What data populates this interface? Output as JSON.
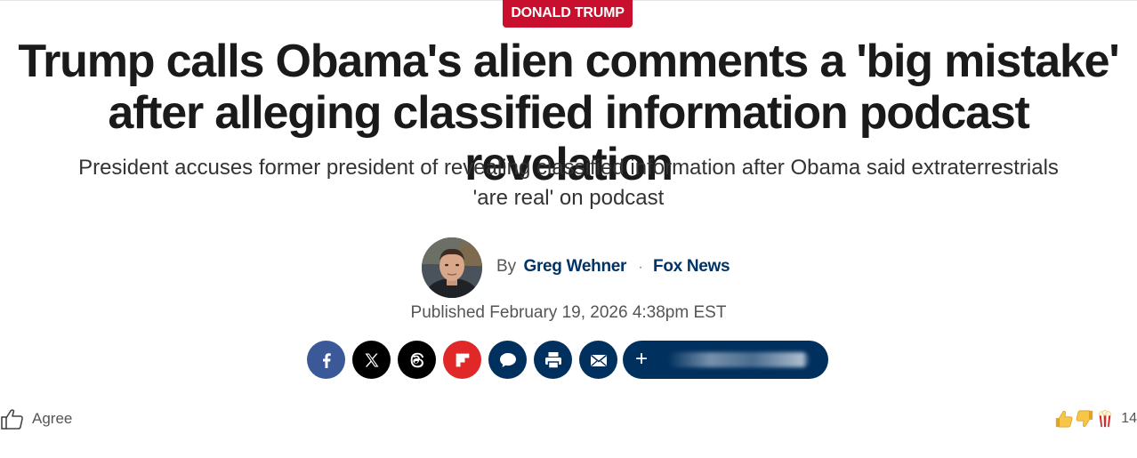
{
  "article": {
    "category": "DONALD TRUMP",
    "headline_line1": "Trump calls Obama's alien comments a 'big mistake'",
    "headline_line2": "after alleging classified information podcast revelation",
    "subhead_line1": "President accuses former president of revealing classified information after Obama said extraterrestrials",
    "subhead_line2": "'are real' on podcast",
    "byline_prefix": "By",
    "author": "Greg Wehner",
    "separator": "·",
    "outlet": "Fox News",
    "published": "Published February 19, 2026 4:38pm EST"
  },
  "share": {
    "buttons": [
      {
        "name": "facebook",
        "icon": "facebook-icon",
        "color": "#3b5998"
      },
      {
        "name": "x",
        "icon": "x-icon",
        "color": "#000000"
      },
      {
        "name": "threads",
        "icon": "threads-icon",
        "color": "#000000"
      },
      {
        "name": "flipboard",
        "icon": "flipboard-icon",
        "color": "#e12828"
      },
      {
        "name": "comments",
        "icon": "comment-icon",
        "color": "#00305e"
      },
      {
        "name": "print",
        "icon": "print-icon",
        "color": "#00305e"
      },
      {
        "name": "email",
        "icon": "email-icon",
        "color": "#00305e"
      }
    ],
    "more_symbol": "+",
    "more_color": "#00305e"
  },
  "reactions": {
    "agree_label": "Agree",
    "icons": [
      "thumbs-up-icon",
      "thumbs-down-icon",
      "popcorn-icon"
    ],
    "count": "14"
  },
  "colors": {
    "category_badge": "#c8102e",
    "author_link": "#003366",
    "headline_text": "#1a1a1a"
  }
}
